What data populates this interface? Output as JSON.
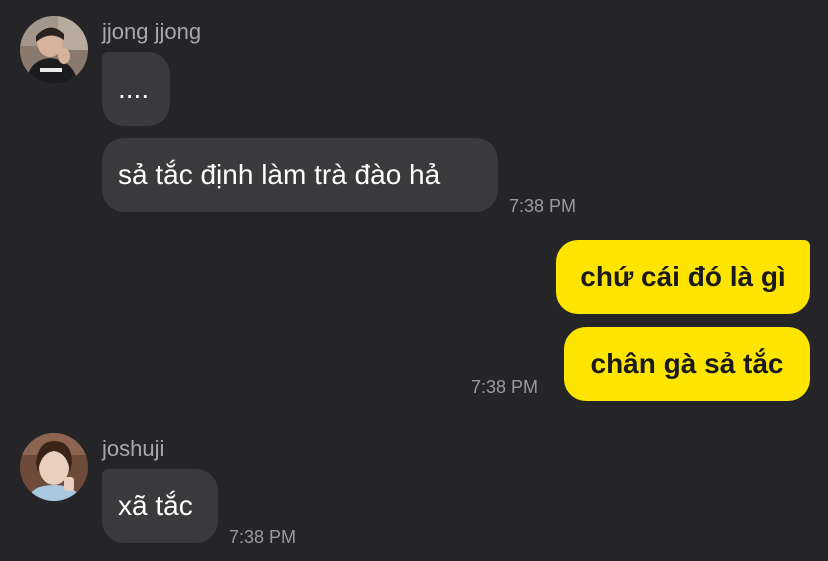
{
  "messages": [
    {
      "sender": "jjong jjong",
      "avatar_icon": "person-photo-avatar",
      "bubbles": [
        "....",
        "sả tắc định làm trà đào hả"
      ],
      "time": "7:38 PM"
    },
    {
      "sender": "me",
      "bubbles": [
        "chứ cái đó là gì",
        "chân gà sả tắc"
      ],
      "time": "7:38 PM"
    },
    {
      "sender": "joshuji",
      "avatar_icon": "person-photo-avatar",
      "bubbles": [
        "xã tắc"
      ],
      "time": "7:38 PM"
    }
  ],
  "colors": {
    "background": "#252527",
    "incoming_bubble": "#3a3a3c",
    "outgoing_bubble": "#fee500"
  }
}
